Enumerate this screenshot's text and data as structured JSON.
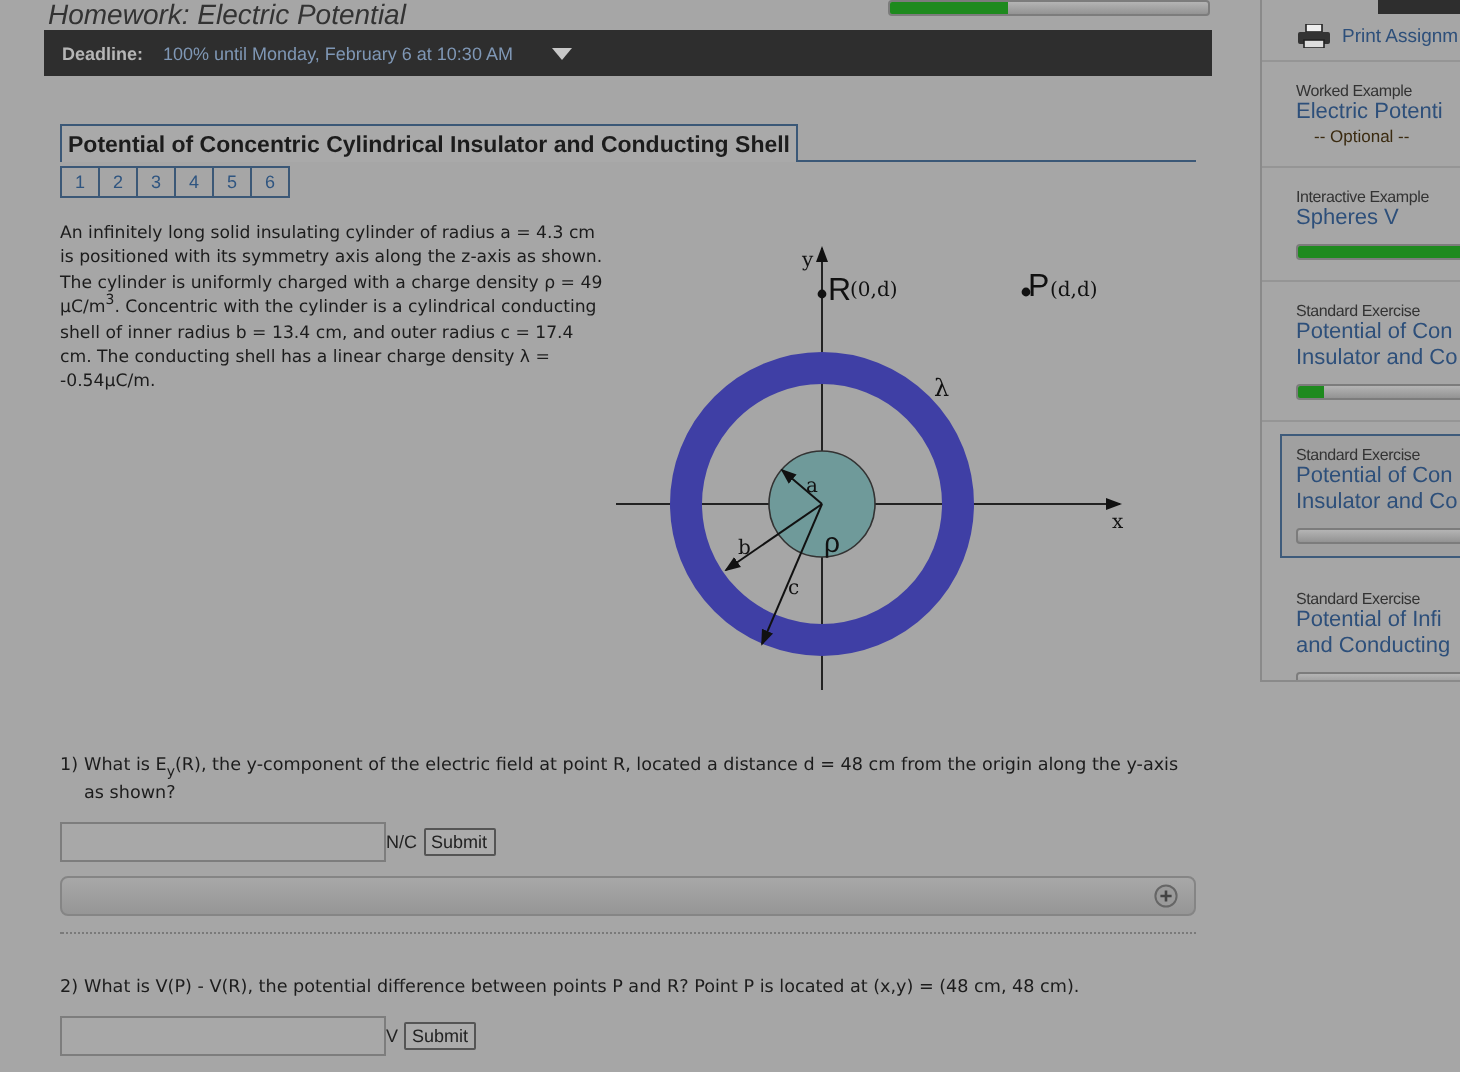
{
  "header": {
    "title": "Homework: Electric Potential",
    "progress": {
      "level": 0.37
    },
    "deadline_label": "Deadline:",
    "deadline_value": "100% until Monday, February 6 at 10:30 AM"
  },
  "problem": {
    "title": "Potential of Concentric Cylindrical Insulator and Conducting Shell",
    "tabs": [
      {
        "label": "1",
        "selected": false
      },
      {
        "label": "2",
        "selected": false
      },
      {
        "label": "3",
        "selected": false
      },
      {
        "label": "4",
        "selected": false
      },
      {
        "label": "5",
        "selected": false
      },
      {
        "label": "6",
        "selected": false
      }
    ],
    "description": "An infinitely long solid insulating cylinder of radius a = 4.3 cm is positioned with its symmetry axis along the z-axis as shown. The cylinder is uniformly charged with a charge density ρ = 49 μC/m$^{3}$. Concentric with the cylinder is a cylindrical conducting shell of inner radius b = 13.4 cm, and outer radius c = 17.4 cm. The conducting shell has a linear charge density λ = -0.54μC/m.",
    "diagram": {
      "labels": [
        "y",
        "R",
        "(0,d)",
        "P",
        "(d,d)",
        "λ",
        "x",
        "a",
        "b",
        "c",
        "ρ"
      ]
    }
  },
  "questions": [
    {
      "number": "1)",
      "text": "What is E$_{y}$(R), the y-component of the electric field at point R, located a distance d = 48 cm from the origin along the y-axis as shown?",
      "unit": "N/C",
      "button": "Submit",
      "hints": {
        "expanded": false
      }
    },
    {
      "number": "2)",
      "text": "What is V(P) - V(R), the potential difference between points P and R? Point P is located at (x,y) = (48 cm, 48 cm).",
      "unit": "V",
      "button": "Submit"
    }
  ],
  "sidebar": {
    "print": "Print Assignm",
    "items": [
      {
        "kind": "worked",
        "type": "Worked Example",
        "title_lines": [
          "Electric Potenti"
        ],
        "note": "-- Optional --",
        "selected": false
      },
      {
        "kind": "exercise",
        "type": "Interactive Example",
        "title_lines": [
          "Spheres V"
        ],
        "level": 1.0,
        "selected": false
      },
      {
        "kind": "exercise",
        "type": "Standard Exercise",
        "title_lines": [
          "Potential of Con",
          "Insulator and Co"
        ],
        "level": 0.15,
        "selected": false
      },
      {
        "kind": "exercise",
        "type": "Standard Exercise",
        "title_lines": [
          "Potential of Con",
          "Insulator and Co"
        ],
        "level": 0,
        "selected": true
      },
      {
        "kind": "exercise",
        "type": "Standard Exercise",
        "title_lines": [
          "Potential of Infi",
          "and Conducting"
        ],
        "level": 0,
        "selected": false
      }
    ]
  }
}
